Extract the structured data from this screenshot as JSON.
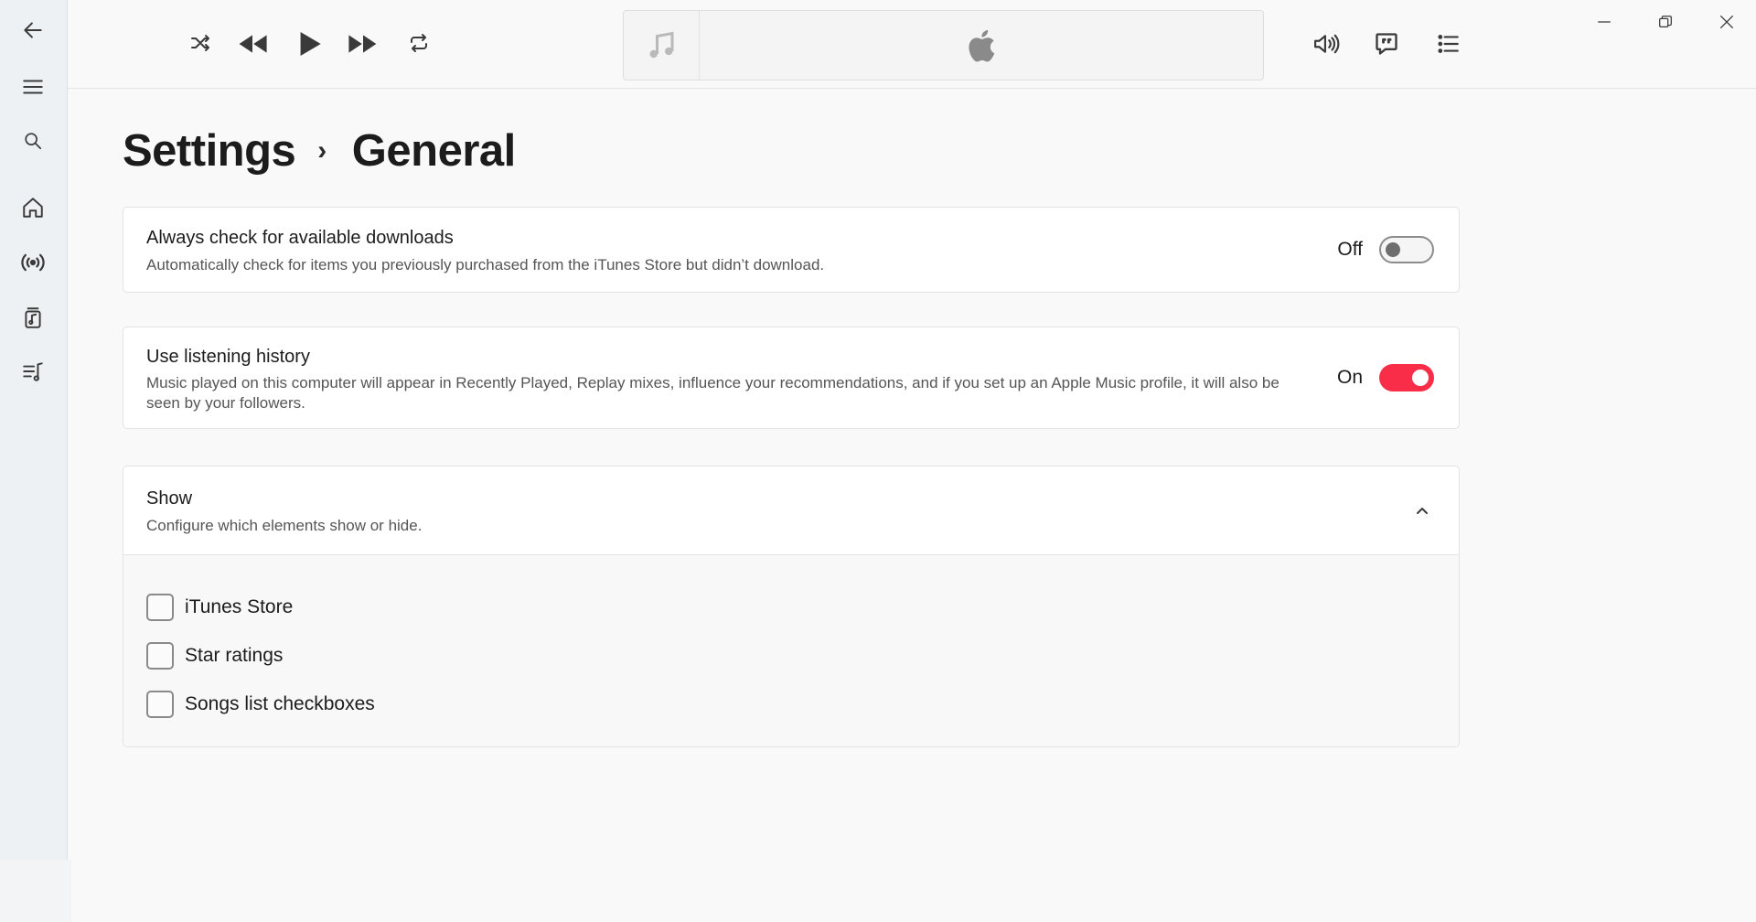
{
  "sidebar": {
    "back_icon": "arrow-left-icon",
    "menu_icon": "hamburger-icon",
    "search_icon": "search-icon",
    "home_icon": "home-icon",
    "radio_icon": "radio-broadcast-icon",
    "library_icon": "library-icon",
    "playlist_icon": "playlist-icon"
  },
  "player": {
    "shuffle_icon": "shuffle-icon",
    "previous_icon": "rewind-icon",
    "play_icon": "play-icon",
    "next_icon": "fast-forward-icon",
    "repeat_icon": "repeat-icon",
    "artwork_icon": "music-note-icon",
    "logo_icon": "apple-logo-icon",
    "volume_icon": "volume-icon",
    "lyrics_icon": "lyrics-icon",
    "queue_icon": "queue-list-icon"
  },
  "window": {
    "minimize_icon": "minimize-icon",
    "restore_icon": "restore-icon",
    "close_icon": "close-icon"
  },
  "breadcrumb": {
    "root": "Settings",
    "separator": "›",
    "current": "General"
  },
  "settings": {
    "downloads": {
      "title": "Always check for available downloads",
      "description": "Automatically check for items you previously purchased from the iTunes Store but didn’t download.",
      "state_label": "Off",
      "enabled": false
    },
    "history": {
      "title": "Use listening history",
      "description": "Music played on this computer will appear in Recently Played, Replay mixes, influence your recommendations, and if you set up an Apple Music profile, it will also be seen by your followers.",
      "state_label": "On",
      "enabled": true
    },
    "show": {
      "title": "Show",
      "description": "Configure which elements show or hide.",
      "expanded": true,
      "options": [
        {
          "label": "iTunes Store",
          "checked": false
        },
        {
          "label": "Star ratings",
          "checked": false
        },
        {
          "label": "Songs list checkboxes",
          "checked": false
        }
      ]
    }
  },
  "colors": {
    "accent": "#fa2d48",
    "sidebar_bg": "#eef1f4",
    "page_bg": "#f9f9f9"
  }
}
